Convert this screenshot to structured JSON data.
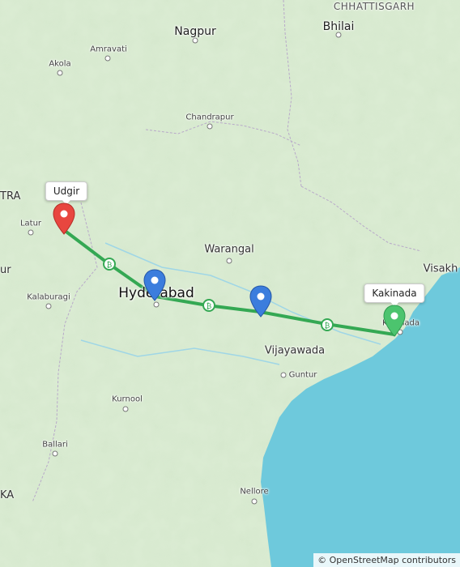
{
  "map": {
    "colors": {
      "land": "#d8ebd0",
      "sea": "#6ec9dc",
      "route": "#34a853",
      "pin_start": "#e8463f",
      "pin_mid": "#3b7ddd",
      "pin_end": "#4cc46e"
    },
    "labels": {
      "chhattisgarh": "CHHATTISGARH",
      "bhilai": "Bhilai",
      "nagpur": "Nagpur",
      "amravati": "Amravati",
      "akola": "Akola",
      "chandrapur": "Chandrapur",
      "latur": "Latur",
      "warangal": "Warangal",
      "hyderabad": "Hyderabad",
      "kalaburagi": "Kalaburagi",
      "visakh": "Visakh",
      "vijayawada": "Vijayawada",
      "guntur": "Guntur",
      "kurnool": "Kurnool",
      "ballari": "Ballari",
      "nellore": "Nellore",
      "kakinada_small": "Kakinada",
      "edge_tra": "TRA",
      "edge_ur": "ur",
      "edge_ka": "KA"
    },
    "callouts": {
      "start": "Udgir",
      "end": "Kakinada"
    },
    "pins": {
      "start_icon": "map-pin-red",
      "mid1_icon": "map-pin-blue",
      "mid2_icon": "map-pin-blue",
      "end_icon": "map-pin-green"
    },
    "route_markers": [
      "toll-icon",
      "toll-icon",
      "toll-icon"
    ],
    "attribution": "© OpenStreetMap contributors"
  }
}
